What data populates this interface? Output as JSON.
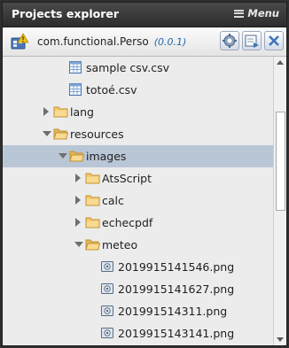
{
  "panel": {
    "title": "Projects explorer",
    "menu_label": "Menu"
  },
  "project": {
    "name": "com.functional.Perso",
    "version": "(0.0.1)",
    "buttons": [
      "settings-icon",
      "export-icon",
      "close-icon"
    ]
  },
  "tree": {
    "items": [
      {
        "label": "sample csv.csv",
        "type": "csv-file",
        "level": 3
      },
      {
        "label": "totoé.csv",
        "type": "csv-file",
        "level": 3
      },
      {
        "label": "lang",
        "type": "folder",
        "expanded": false,
        "level": 1
      },
      {
        "label": "resources",
        "type": "folder",
        "expanded": true,
        "level": 1
      },
      {
        "label": "images",
        "type": "folder",
        "expanded": true,
        "level": 2,
        "selected": true
      },
      {
        "label": "AtsScript",
        "type": "folder",
        "expanded": false,
        "level": 3
      },
      {
        "label": "calc",
        "type": "folder",
        "expanded": false,
        "level": 3
      },
      {
        "label": "echecpdf",
        "type": "folder",
        "expanded": false,
        "level": 3
      },
      {
        "label": "meteo",
        "type": "folder",
        "expanded": true,
        "level": 3
      },
      {
        "label": "2019915141546.png",
        "type": "image-file",
        "level": 4
      },
      {
        "label": "2019915141627.png",
        "type": "image-file",
        "level": 4
      },
      {
        "label": "201991514311.png",
        "type": "image-file",
        "level": 4
      },
      {
        "label": "2019915143141.png",
        "type": "image-file",
        "level": 4
      }
    ]
  },
  "colors": {
    "title_bg": "#3a3a3a",
    "selection": "#b9c6d6",
    "version_text": "#2266aa",
    "folder": "#f2c66b"
  }
}
